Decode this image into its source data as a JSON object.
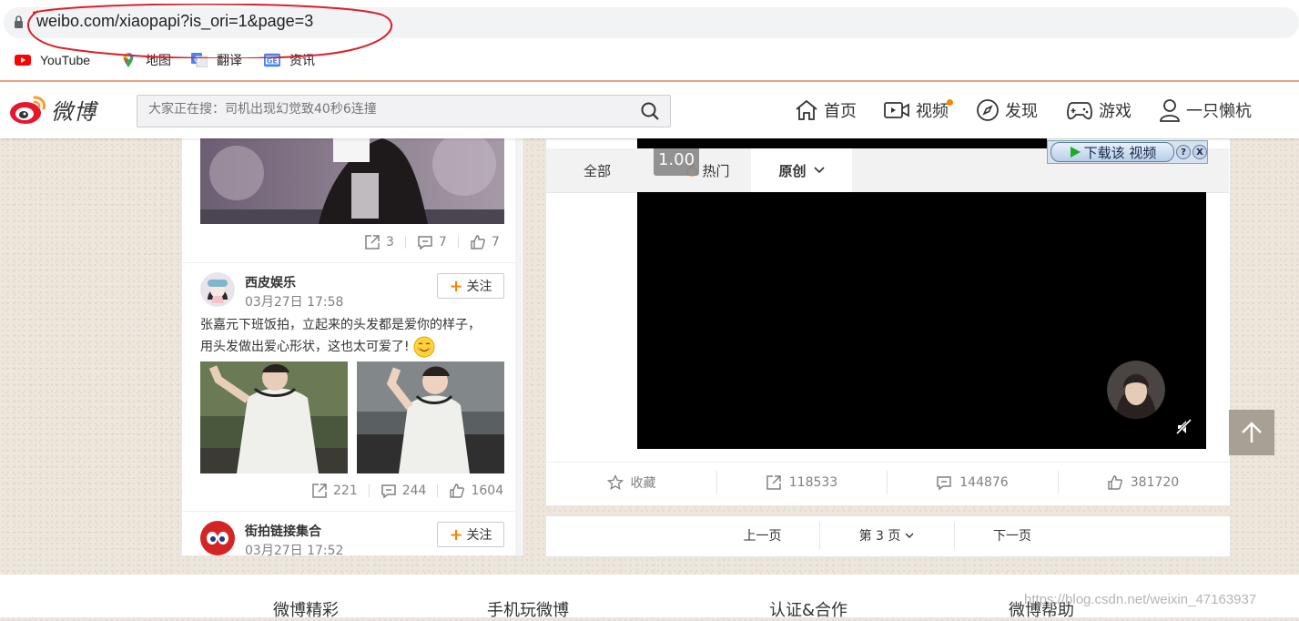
{
  "browser": {
    "url": "weibo.com/xiaopapi?is_ori=1&page=3",
    "bookmarks": [
      {
        "label": "YouTube",
        "icon": "youtube-icon"
      },
      {
        "label": "地图",
        "icon": "maps-icon"
      },
      {
        "label": "翻译",
        "icon": "translate-icon"
      },
      {
        "label": "资讯",
        "icon": "news-icon"
      }
    ]
  },
  "header": {
    "logo_text": "微博",
    "search_placeholder": "大家正在搜：司机出现幻觉致40秒6连撞",
    "nav": [
      {
        "label": "首页",
        "icon": "home-icon"
      },
      {
        "label": "视频",
        "icon": "video-icon"
      },
      {
        "label": "发现",
        "icon": "compass-icon"
      },
      {
        "label": "游戏",
        "icon": "gamepad-icon"
      },
      {
        "label": "一只懒杭",
        "icon": "user-icon"
      }
    ],
    "accent": "#ff8200"
  },
  "left_feed": {
    "post1_stats": {
      "repost": "3",
      "comment": "7",
      "like": "7"
    },
    "post2": {
      "author": "西皮娱乐",
      "time": "03月27日 17:58",
      "follow": "关注",
      "text_line1": "张嘉元下班饭拍，立起来的头发都是爱你的样子，",
      "text_line2": "用头发做出爱心形状，这也太可爱了!",
      "stats": {
        "repost": "221",
        "comment": "244",
        "like": "1604"
      }
    },
    "post3": {
      "author": "街拍链接集合",
      "time": "03月27日 17:52",
      "follow": "关注"
    }
  },
  "right_card": {
    "tabs": [
      "全部",
      "热门",
      "原创"
    ],
    "active_tab": "原创",
    "speed": "1.00",
    "download_label": "下载该 视频",
    "help": "?",
    "close": "X",
    "actions": {
      "favorite": "收藏",
      "repost": "118533",
      "comment": "144876",
      "like": "381720"
    }
  },
  "pager": {
    "prev": "上一页",
    "current": "第 3 页",
    "next": "下一页"
  },
  "footer": {
    "links": [
      "微博精彩",
      "手机玩微博",
      "认证&合作",
      "微博帮助"
    ],
    "watermark": "https://blog.csdn.net/weixin_47163937"
  }
}
